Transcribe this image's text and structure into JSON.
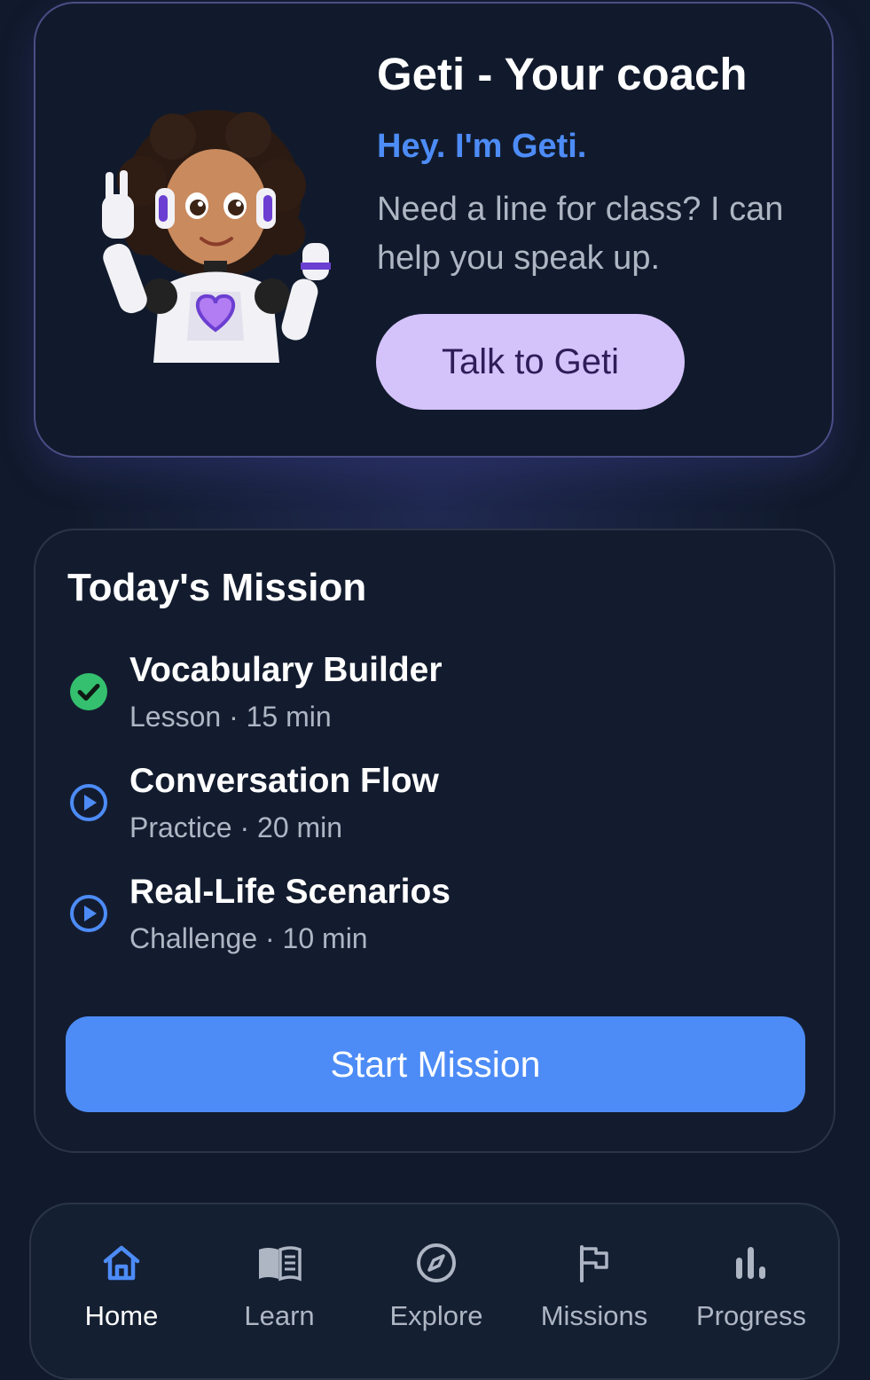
{
  "coach": {
    "title": "Geti - Your coach",
    "greeting": "Hey. I'm Geti.",
    "message": "Need a line for class? I can help you speak up.",
    "talk_button_label": "Talk to Geti"
  },
  "mission": {
    "title": "Today's Mission",
    "items": [
      {
        "title": "Vocabulary Builder",
        "meta": "Lesson · 15 min",
        "status": "completed"
      },
      {
        "title": "Conversation Flow",
        "meta": "Practice · 20 min",
        "status": "pending"
      },
      {
        "title": "Real-Life Scenarios",
        "meta": "Challenge · 10 min",
        "status": "pending"
      }
    ],
    "start_button_label": "Start Mission"
  },
  "nav": {
    "items": [
      {
        "label": "Home",
        "icon": "home-icon",
        "active": true
      },
      {
        "label": "Learn",
        "icon": "book-icon",
        "active": false
      },
      {
        "label": "Explore",
        "icon": "compass-icon",
        "active": false
      },
      {
        "label": "Missions",
        "icon": "flag-icon",
        "active": false
      },
      {
        "label": "Progress",
        "icon": "bar-chart-icon",
        "active": false
      }
    ]
  },
  "colors": {
    "background": "#111a2c",
    "accent_blue": "#4d8cf7",
    "accent_purple": "#d4c3fb",
    "success_green": "#34c06e",
    "muted_text": "#aeb6c4"
  }
}
